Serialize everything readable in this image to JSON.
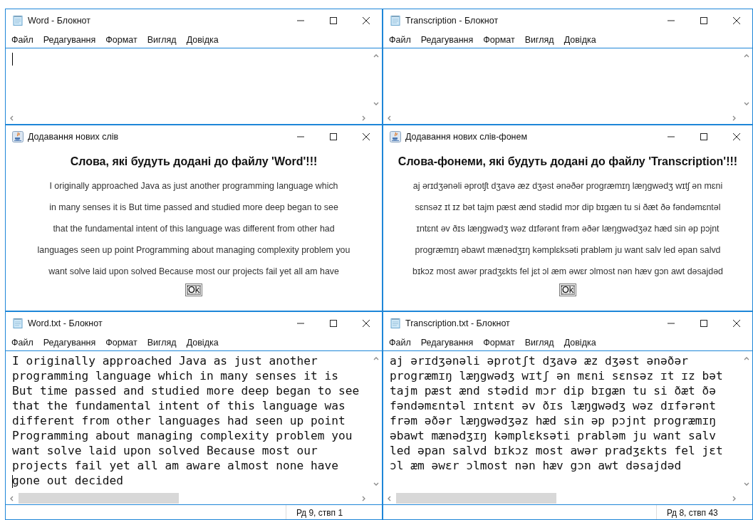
{
  "windows": [
    {
      "kind": "notepad",
      "title": "Word - Блокнот",
      "menu": [
        "Файл",
        "Редагування",
        "Формат",
        "Вигляд",
        "Довідка"
      ],
      "caret": true
    },
    {
      "kind": "notepad",
      "title": "Transcription - Блокнот",
      "menu": [
        "Файл",
        "Редагування",
        "Формат",
        "Вигляд",
        "Довідка"
      ],
      "caret": false
    },
    {
      "kind": "dialog",
      "title": "Додавання нових слів",
      "heading": "Слова, які будуть додані до файлу 'Word'!!!",
      "lines": [
        "I originally approached Java as just another programming language which",
        "in many senses it is But time passed and studied more deep began to see",
        "that the fundamental intent of this language was different from other had",
        "languages seen up point Programming about managing complexity problem you",
        "want solve laid upon solved Because most our projects fail yet all am have"
      ],
      "button": "Ok"
    },
    {
      "kind": "dialog",
      "title": "Додавання нових слів-фонем",
      "heading": "Слова-фонеми, які будуть додані до файлу 'Transcription'!!!",
      "lines": [
        "aj ərɪdʒənəli əprotʃt dʒavə æz dʒəst ənəðər progræmɪŋ læŋgwədʒ wɪtʃ ən mɛni",
        "sɛnsəz ɪt ɪz bət tajm pæst ænd stədid mɔr dip bɪgæn tu si ðæt ðə fəndəmɛntəl",
        "ɪntɛnt əv ðɪs læŋgwədʒ wəz dɪfərənt frəm əðər læŋgwədʒəz hæd sin əp pɔjnt",
        "progræmɪŋ əbawt mænədʒɪŋ kəmplɛksəti prabləm ju want salv led əpan salvd",
        "bɪkɔz most awər pradʒɛkts fel jɛt ɔl æm əwɛr ɔlmost nən hæv gɔn awt dəsajdəd"
      ],
      "button": "Ok"
    },
    {
      "kind": "notepad",
      "title": "Word.txt - Блокнот",
      "menu": [
        "Файл",
        "Редагування",
        "Формат",
        "Вигляд",
        "Довідка"
      ],
      "caret": true,
      "lines": [
        "I originally approached Java as just another",
        "programming language which in many senses it is",
        "But time passed and studied more deep began to see",
        "that the fundamental intent of this language was",
        "different from other languages had seen up point",
        "Programming about managing complexity problem you",
        "want solve laid upon solved Because most our",
        "projects fail yet all am aware almost none have",
        "gone out decided"
      ],
      "status": "Рд 9, ствп 1"
    },
    {
      "kind": "notepad",
      "title": "Transcription.txt - Блокнот",
      "menu": [
        "Файл",
        "Редагування",
        "Формат",
        "Вигляд",
        "Довідка"
      ],
      "caret": false,
      "lines": [
        "aj ərɪdʒənəli əprotʃt dʒavə æz dʒəst ənəðər",
        "progræmɪŋ læŋgwədʒ wɪtʃ ən mɛni sɛnsəz ɪt ɪz bət",
        "tajm pæst ænd stədid mɔr dip bɪgæn tu si ðæt ðə",
        "fəndəmɛntəl ɪntɛnt əv ðɪs læŋgwədʒ wəz dɪfərənt",
        "frəm əðər læŋgwədʒəz hæd sin əp pɔjnt progræmɪŋ",
        "əbawt mænədʒɪŋ kəmplɛksəti prabləm ju want salv",
        "led əpan salvd bɪkɔz most awər pradʒɛkts fel jɛt",
        "ɔl æm əwɛr ɔlmost nən hæv gɔn awt dəsajdəd"
      ],
      "status": "Рд 8, ствп 43"
    }
  ]
}
